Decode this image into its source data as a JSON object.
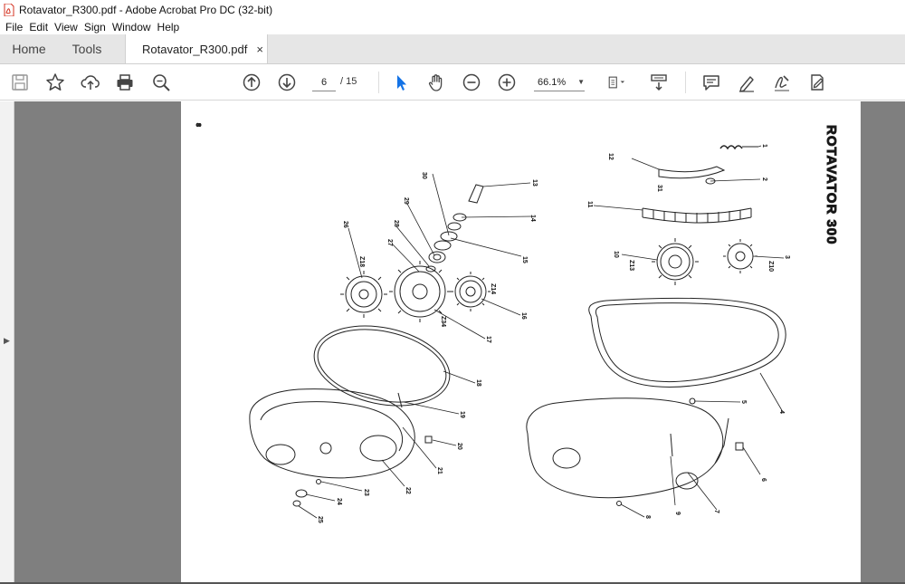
{
  "window": {
    "title": "Rotavator_R300.pdf - Adobe Acrobat Pro DC (32-bit)"
  },
  "menu": [
    "File",
    "Edit",
    "View",
    "Sign",
    "Window",
    "Help"
  ],
  "tabs": {
    "home": "Home",
    "tools": "Tools",
    "document": "Rotavator_R300.pdf",
    "close": "×"
  },
  "toolbar": {
    "icons": [
      "save-icon",
      "bookmark-star-icon",
      "upload-icon",
      "print-icon",
      "zoom-search-icon",
      "page-up-icon",
      "page-down-icon",
      "select-arrow-icon",
      "hand-icon",
      "zoom-out-icon",
      "zoom-in-icon",
      "fit-page-icon",
      "scroll-mode-icon",
      "comment-icon",
      "highlight-pen-icon",
      "sign-icon",
      "fill-sign-icon"
    ],
    "page_current": "6",
    "page_total": "/ 15",
    "zoom": "66.1%"
  },
  "document": {
    "title": "ROTAVATOR  300",
    "page_number_mark": "8",
    "part_numbers": [
      "1",
      "2",
      "3",
      "4",
      "5",
      "6",
      "7",
      "8",
      "9",
      "10",
      "11",
      "12",
      "13",
      "14",
      "15",
      "16",
      "17",
      "18",
      "19",
      "20",
      "21",
      "22",
      "23",
      "24",
      "25",
      "26",
      "27",
      "28",
      "29",
      "30",
      "31"
    ],
    "gear_tooth_labels": [
      "Z10",
      "Z13",
      "Z14",
      "Z18",
      "Z34"
    ]
  },
  "colors": {
    "accent_blue": "#1473e6",
    "pdf_red": "#d4301f",
    "workspace_grey": "#7f7f7f"
  }
}
